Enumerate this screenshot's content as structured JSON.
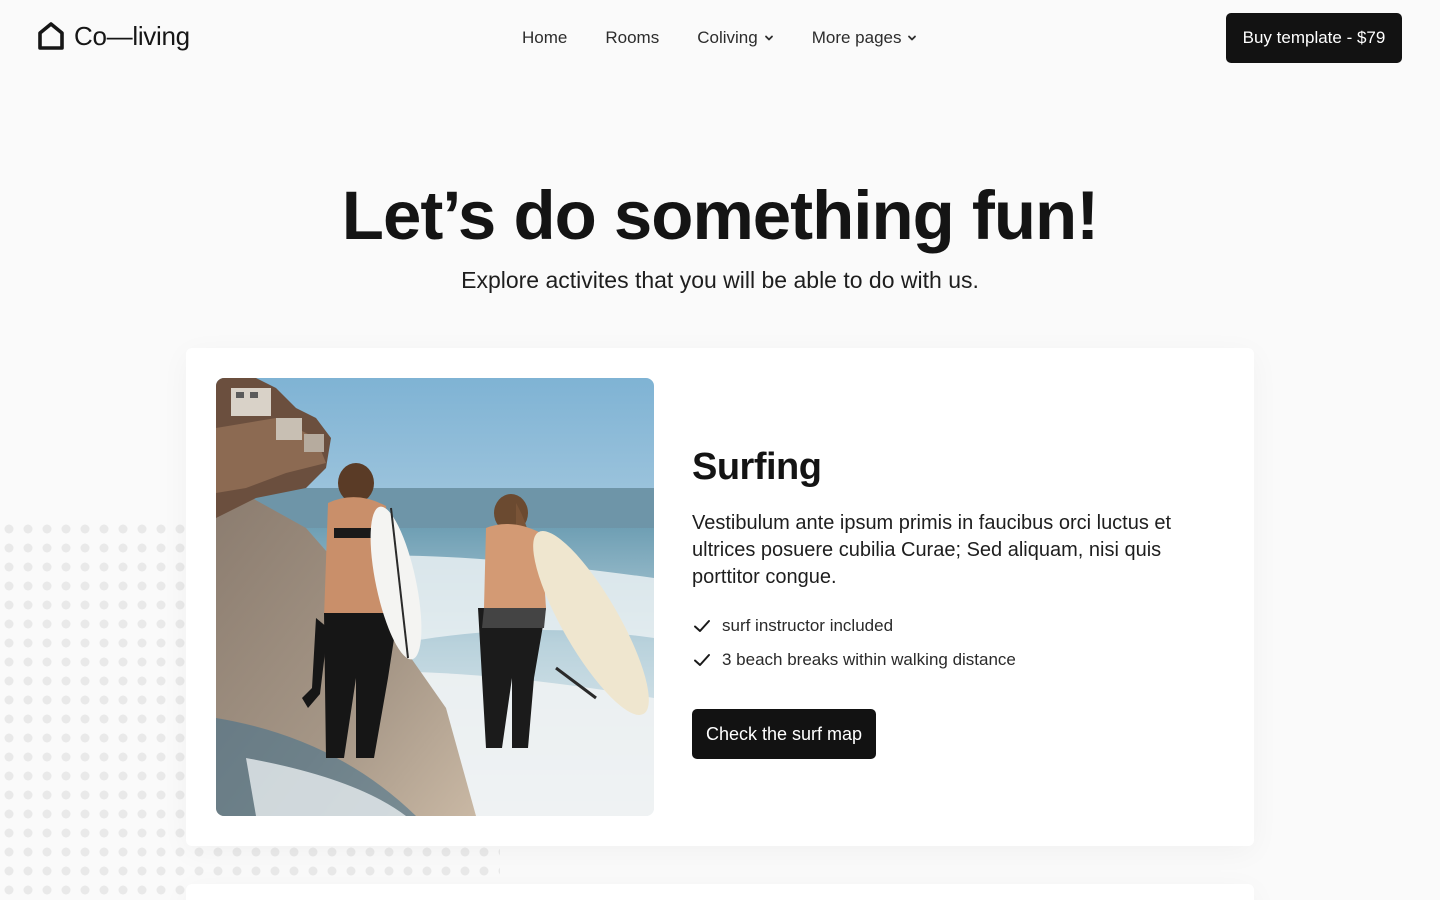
{
  "header": {
    "logo_text": "Co—living",
    "nav": {
      "home": "Home",
      "rooms": "Rooms",
      "coliving": "Coliving",
      "more_pages": "More pages"
    },
    "buy_label": "Buy template - $79"
  },
  "hero": {
    "title": "Let’s do something fun!",
    "subtitle": "Explore activites that you will be able to do with us."
  },
  "activity": {
    "title": "Surfing",
    "description": "Vestibulum ante ipsum primis in faucibus orci luctus et ultrices posuere cubilia Curae; Sed aliquam, nisi quis porttitor congue.",
    "features": [
      "surf instructor included",
      "3 beach breaks within walking distance"
    ],
    "cta_label": "Check the surf map",
    "image_alt": "Two surfers walking on the beach with surfboards"
  },
  "colors": {
    "background": "#fafafa",
    "card": "#ffffff",
    "button": "#121212",
    "text": "#161616"
  },
  "icons": {
    "logo": "house-icon",
    "dropdown": "chevron-down-icon",
    "check": "check-icon"
  }
}
